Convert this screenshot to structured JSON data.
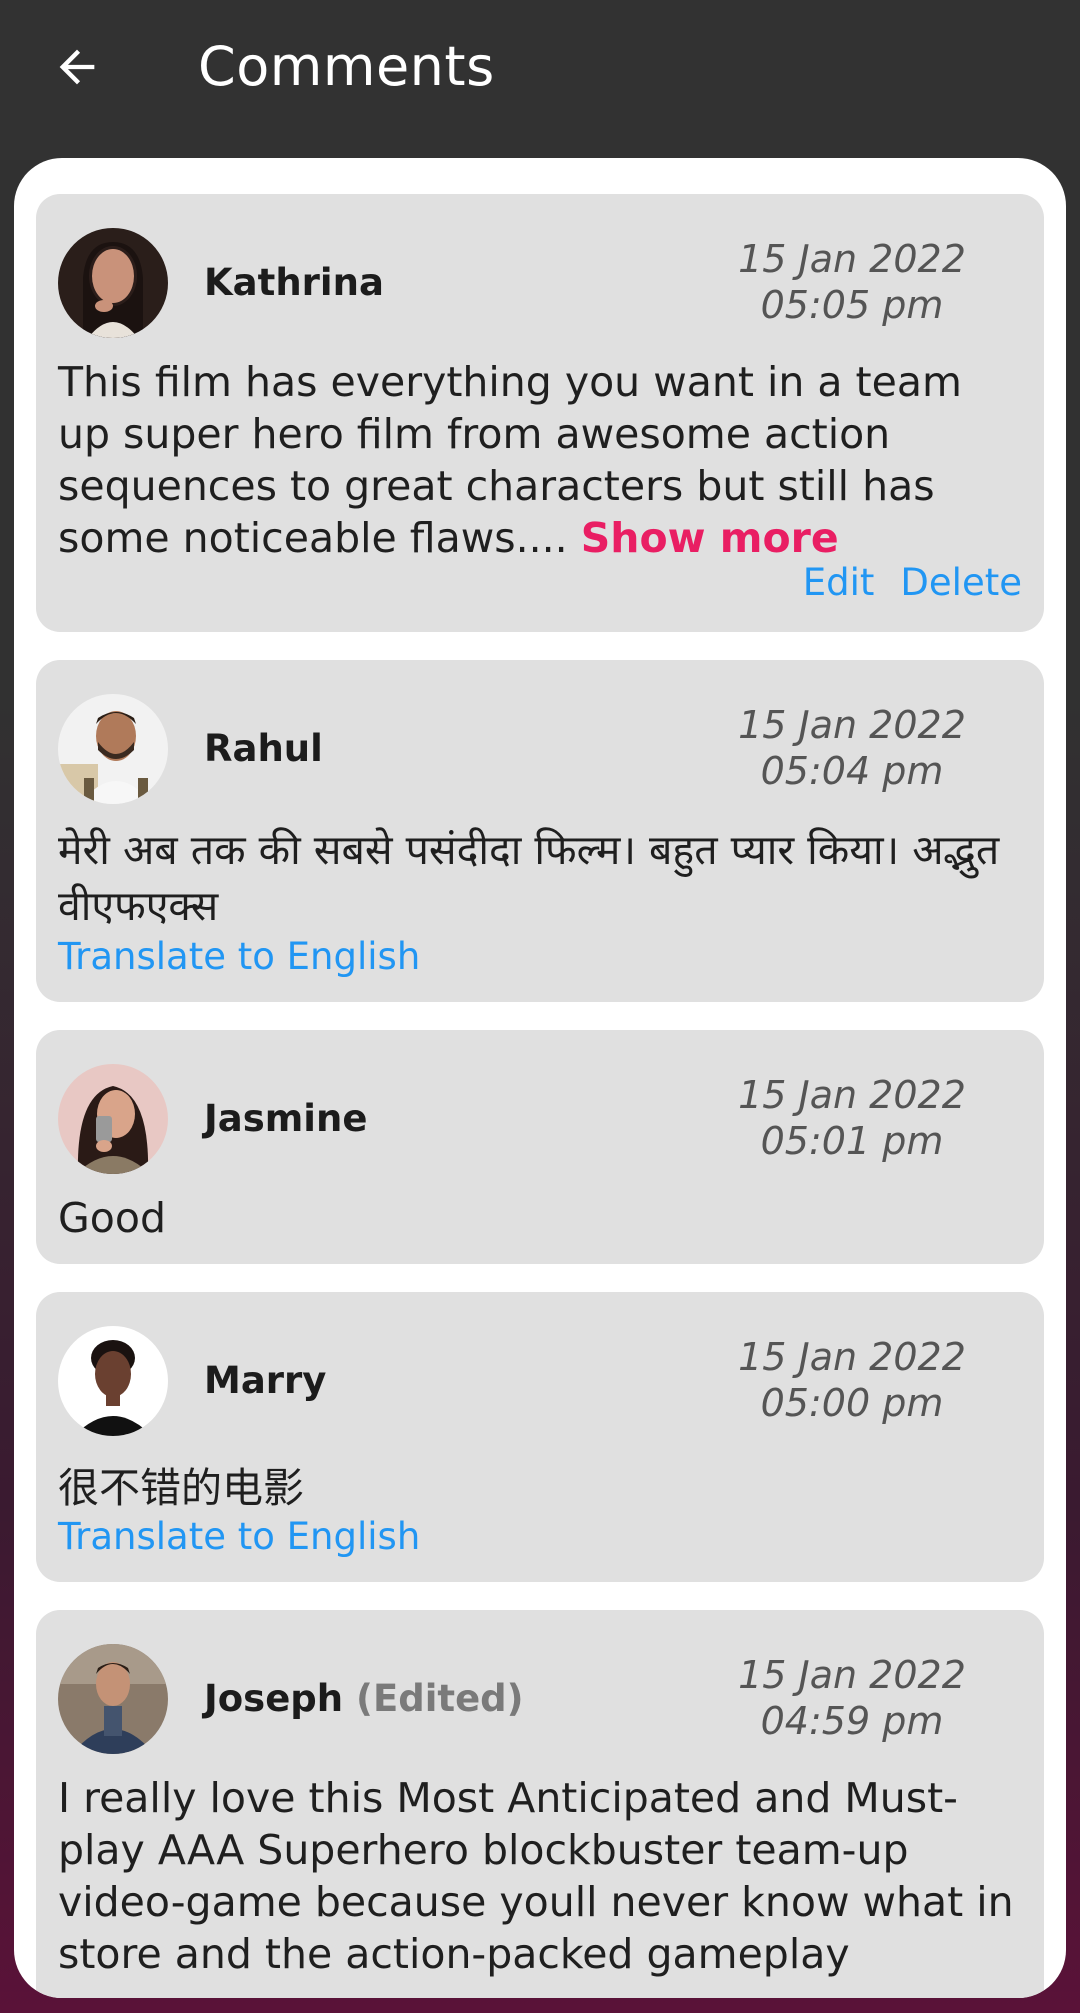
{
  "header": {
    "back_icon": "arrow-left-icon",
    "title": "Comments"
  },
  "colors": {
    "accent_link": "#2196f3",
    "show_more": "#e91e63",
    "card_bg": "#e0e0e0",
    "header_bg": "#323232"
  },
  "comments": [
    {
      "name": "Kathrina",
      "edited": "",
      "date": "15 Jan 2022",
      "time": "05:05 pm",
      "text": "This film has everything you want in a team up super hero film from awesome action sequences to great characters but still has some noticeable flaws.... ",
      "show_more": "Show more",
      "edit": "Edit",
      "delete": "Delete"
    },
    {
      "name": "Rahul",
      "edited": "",
      "date": "15 Jan 2022",
      "time": "05:04 pm",
      "text": "मेरी अब तक की सबसे पसंदीदा फिल्म। बहुत प्यार किया। अद्भुत वीएफएक्स",
      "translate": "Translate to English"
    },
    {
      "name": "Jasmine",
      "edited": "",
      "date": "15 Jan 2022",
      "time": "05:01 pm",
      "text": "Good"
    },
    {
      "name": "Marry",
      "edited": "",
      "date": "15 Jan 2022",
      "time": "05:00 pm",
      "text": "很不错的电影",
      "translate": "Translate to English"
    },
    {
      "name": "Joseph",
      "edited": "(Edited)",
      "date": "15 Jan 2022",
      "time": "04:59 pm",
      "text": "I really love this Most Anticipated and Must-play AAA Superhero blockbuster team-up video-game because youll never know what in store and the action-packed gameplay"
    }
  ]
}
